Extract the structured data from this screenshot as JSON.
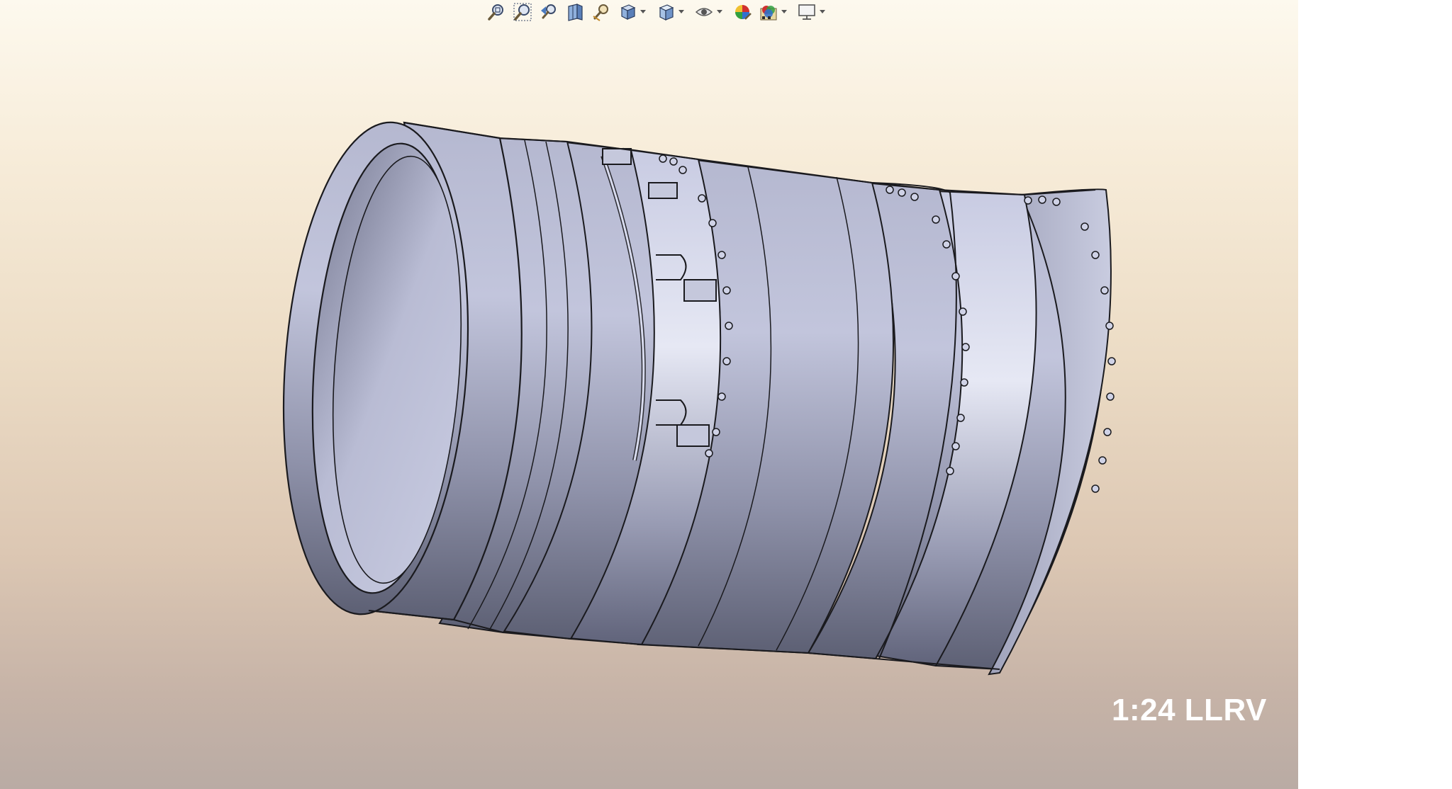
{
  "viewport": {
    "scale_label": "1:24 LLRV"
  },
  "toolbar": {
    "items": [
      {
        "icon": "zoom-to-fit-icon",
        "dropdown": false
      },
      {
        "icon": "zoom-to-area-icon",
        "dropdown": false
      },
      {
        "icon": "previous-view-icon",
        "dropdown": false
      },
      {
        "icon": "section-view-icon",
        "dropdown": false
      },
      {
        "icon": "dynamic-annotation-views-icon",
        "dropdown": false
      },
      {
        "icon": "view-orientation-icon",
        "dropdown": true
      },
      {
        "icon": "display-style-icon",
        "dropdown": true
      },
      {
        "icon": "hide-show-items-icon",
        "dropdown": true
      },
      {
        "icon": "edit-appearance-icon",
        "dropdown": false
      },
      {
        "icon": "apply-scene-icon",
        "dropdown": true
      },
      {
        "icon": "view-settings-icon",
        "dropdown": true
      }
    ]
  },
  "colors": {
    "part_body": "#b9bcd4",
    "part_outline": "#1a1a1e",
    "background_top": "#fdf9ee",
    "background_bottom": "#b9aba4"
  }
}
